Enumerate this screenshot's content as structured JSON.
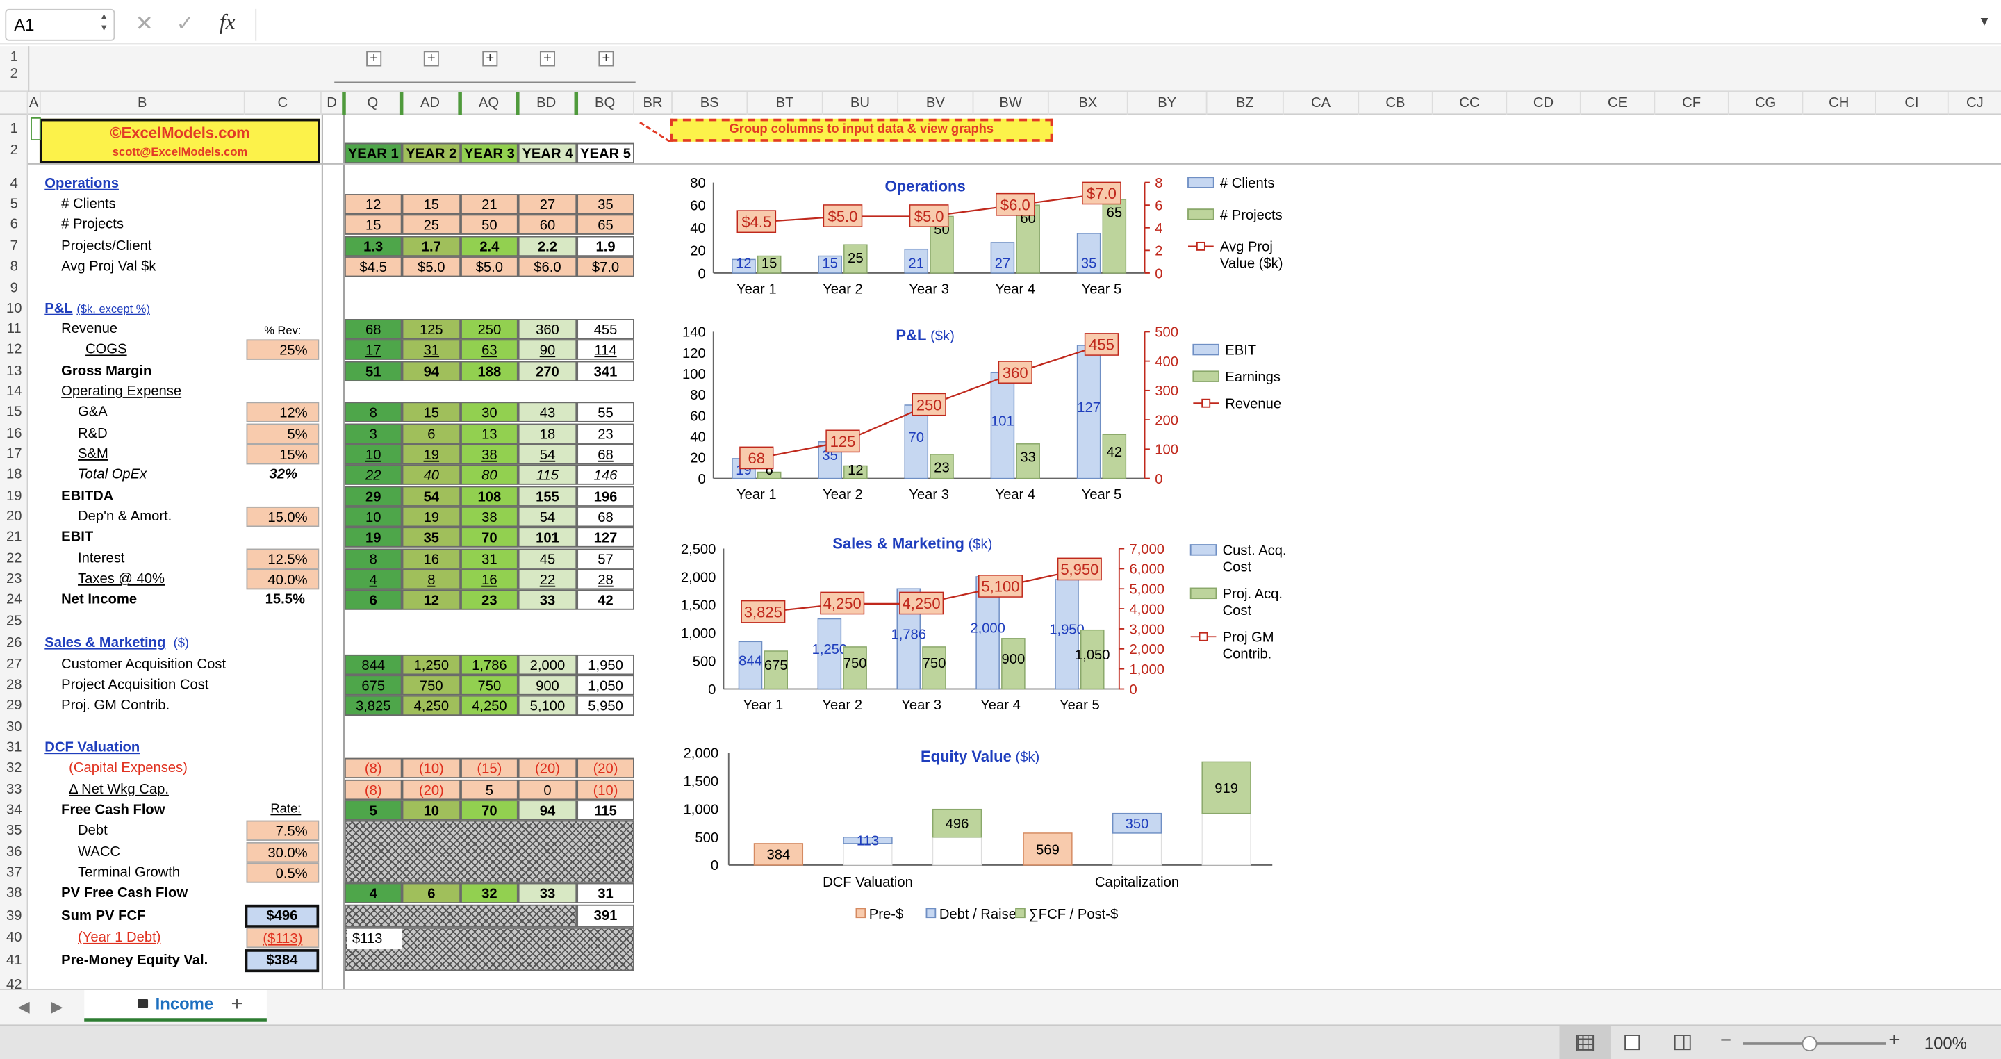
{
  "formula_bar": {
    "cell": "A1",
    "cancel": "✕",
    "confirm": "✓",
    "fx": "fx",
    "formula": ""
  },
  "group_bar": {
    "levels": [
      "1",
      "2"
    ],
    "plus": "+"
  },
  "col_headers": [
    "A",
    "B",
    "C",
    "D",
    "Q",
    "AD",
    "AQ",
    "BD",
    "BQ",
    "BR",
    "BS",
    "BT",
    "BU",
    "BV",
    "BW",
    "BX",
    "BY",
    "BZ",
    "CA",
    "CB",
    "CC",
    "CD",
    "CE",
    "CF",
    "CG",
    "CH",
    "CI",
    "CJ"
  ],
  "row_headers": [
    "1",
    "2",
    "",
    "4",
    "5",
    "6",
    "7",
    "8",
    "9",
    "10",
    "11",
    "12",
    "13",
    "14",
    "15",
    "16",
    "17",
    "18",
    "19",
    "20",
    "21",
    "22",
    "23",
    "24",
    "25",
    "26",
    "27",
    "28",
    "29",
    "30",
    "31",
    "32",
    "33",
    "34",
    "35",
    "36",
    "37",
    "38",
    "39",
    "40",
    "41",
    "42"
  ],
  "header": {
    "brand": "©ExcelModels.com",
    "email": "scott@ExcelModels.com",
    "note": "Group columns to input data & view graphs",
    "years": [
      "YEAR 1",
      "YEAR 2",
      "YEAR 3",
      "YEAR 4",
      "YEAR 5"
    ]
  },
  "labels": {
    "ops": "Operations",
    "clients": "# Clients",
    "projects": "# Projects",
    "ppc": "Projects/Client",
    "apv": "Avg Proj Val $k",
    "pl": "P&L",
    "pl_sub": "($k, except %)",
    "pct_rev": "% Rev:",
    "revenue": "Revenue",
    "cogs": "COGS",
    "gm": "Gross Margin",
    "opex": "Operating Expense",
    "ga": "G&A",
    "rd": "R&D",
    "sm": "S&M",
    "total_opex": "Total OpEx",
    "ebitda": "EBITDA",
    "da": "Dep'n & Amort.",
    "ebit": "EBIT",
    "interest": "Interest",
    "taxes": "Taxes @ 40%",
    "ni": "Net Income",
    "sales": "Sales & Marketing",
    "sales_sub": "($)",
    "cac": "Customer Acquisition Cost",
    "pac": "Project Acquisition Cost",
    "pgm": "Proj. GM Contrib.",
    "dcf": "DCF Valuation",
    "capex": "(Capital Expenses)",
    "nwc": "Δ Net Wkg Cap.",
    "fcf": "Free Cash Flow",
    "rate": "Rate:",
    "debt": "Debt",
    "wacc": "WACC",
    "tg": "Terminal Growth",
    "pvfcf": "PV Free Cash Flow",
    "sumpv": "Sum PV FCF",
    "y1debt": "(Year 1 Debt)",
    "premoney": "Pre-Money Equity Val."
  },
  "col_c": {
    "cogs": "25%",
    "ga": "12%",
    "rd": "5%",
    "sm": "15%",
    "total_opex": "32%",
    "da": "15.0%",
    "interest": "12.5%",
    "taxes": "40.0%",
    "ni": "15.5%",
    "debt": "7.5%",
    "wacc": "30.0%",
    "tg": "0.5%",
    "sumpv": "$496",
    "y1debt": "($113)",
    "premoney": "$384"
  },
  "rows": {
    "clients": [
      "12",
      "15",
      "21",
      "27",
      "35"
    ],
    "projects": [
      "15",
      "25",
      "50",
      "60",
      "65"
    ],
    "ppc": [
      "1.3",
      "1.7",
      "2.4",
      "2.2",
      "1.9"
    ],
    "apv": [
      "$4.5",
      "$5.0",
      "$5.0",
      "$6.0",
      "$7.0"
    ],
    "revenue": [
      "68",
      "125",
      "250",
      "360",
      "455"
    ],
    "cogs": [
      "17",
      "31",
      "63",
      "90",
      "114"
    ],
    "gm": [
      "51",
      "94",
      "188",
      "270",
      "341"
    ],
    "ga": [
      "8",
      "15",
      "30",
      "43",
      "55"
    ],
    "rd": [
      "3",
      "6",
      "13",
      "18",
      "23"
    ],
    "sm": [
      "10",
      "19",
      "38",
      "54",
      "68"
    ],
    "total_opex": [
      "22",
      "40",
      "80",
      "115",
      "146"
    ],
    "ebitda": [
      "29",
      "54",
      "108",
      "155",
      "196"
    ],
    "da": [
      "10",
      "19",
      "38",
      "54",
      "68"
    ],
    "ebit": [
      "19",
      "35",
      "70",
      "101",
      "127"
    ],
    "interest": [
      "8",
      "16",
      "31",
      "45",
      "57"
    ],
    "taxes": [
      "4",
      "8",
      "16",
      "22",
      "28"
    ],
    "ni": [
      "6",
      "12",
      "23",
      "33",
      "42"
    ],
    "cac": [
      "844",
      "1,250",
      "1,786",
      "2,000",
      "1,950"
    ],
    "pac": [
      "675",
      "750",
      "750",
      "900",
      "1,050"
    ],
    "pgm": [
      "3,825",
      "4,250",
      "4,250",
      "5,100",
      "5,950"
    ],
    "capex": [
      "(8)",
      "(10)",
      "(15)",
      "(20)",
      "(20)"
    ],
    "nwc": [
      "(8)",
      "(20)",
      "5",
      "0",
      "(10)"
    ],
    "fcf": [
      "5",
      "10",
      "70",
      "94",
      "115"
    ],
    "pvfcf": [
      "4",
      "6",
      "32",
      "33",
      "31"
    ],
    "terminal": "391",
    "y1debt_val": "$113"
  },
  "colors": {
    "green_dark": "#4ea64a",
    "green_mid": "#a0bf5b",
    "green_light": "#92d050",
    "green_pale": "#d8e8c4",
    "peach": "#f8cbad",
    "blue_bar": "#c6d7f1",
    "green_bar": "#bdd49c",
    "red_line": "#c0281c",
    "yellow": "#fcf24a"
  },
  "chart_data": [
    {
      "type": "bar",
      "title": "Operations",
      "categories": [
        "Year 1",
        "Year 2",
        "Year 3",
        "Year 4",
        "Year 5"
      ],
      "series": [
        {
          "name": "# Clients",
          "values": [
            12,
            15,
            21,
            27,
            35
          ]
        },
        {
          "name": "# Projects",
          "values": [
            15,
            25,
            50,
            60,
            65
          ]
        },
        {
          "name": "Avg Proj Value ($k)",
          "type": "line",
          "axis": "right",
          "values": [
            4.5,
            5.0,
            5.0,
            6.0,
            7.0
          ],
          "labels": [
            "$4.5",
            "$5.0",
            "$5.0",
            "$6.0",
            "$7.0"
          ]
        }
      ],
      "ylim": [
        0,
        80
      ],
      "yticks": [
        "0",
        "20",
        "40",
        "60",
        "80"
      ],
      "y2lim": [
        0,
        8
      ],
      "y2ticks": [
        "0",
        "2",
        "4",
        "6",
        "8"
      ],
      "legend": "right"
    },
    {
      "type": "bar",
      "title": "P&L",
      "title_sub": "($k)",
      "categories": [
        "Year 1",
        "Year 2",
        "Year 3",
        "Year 4",
        "Year 5"
      ],
      "series": [
        {
          "name": "EBIT",
          "values": [
            19,
            35,
            70,
            101,
            127
          ],
          "labels": [
            "19",
            "35",
            "70",
            "101",
            "127"
          ]
        },
        {
          "name": "Earnings",
          "values": [
            6,
            12,
            23,
            33,
            42
          ],
          "labels": [
            "6",
            "12",
            "23",
            "33",
            "42"
          ]
        },
        {
          "name": "Revenue",
          "type": "line",
          "axis": "right",
          "values": [
            68,
            125,
            250,
            360,
            455
          ],
          "labels": [
            "68",
            "125",
            "250",
            "360",
            "455"
          ]
        }
      ],
      "ylim": [
        0,
        140
      ],
      "yticks": [
        "0",
        "20",
        "40",
        "60",
        "80",
        "100",
        "120",
        "140"
      ],
      "y2lim": [
        0,
        500
      ],
      "y2ticks": [
        "0",
        "100",
        "200",
        "300",
        "400",
        "500"
      ],
      "legend": "right"
    },
    {
      "type": "bar",
      "title": "Sales & Marketing",
      "title_sub": "($k)",
      "categories": [
        "Year 1",
        "Year 2",
        "Year 3",
        "Year 4",
        "Year 5"
      ],
      "series": [
        {
          "name": "Cust. Acq. Cost",
          "values": [
            844,
            1250,
            1786,
            2000,
            1950
          ],
          "labels": [
            "844",
            "1,250",
            "1,786",
            "2,000",
            "1,950"
          ]
        },
        {
          "name": "Proj. Acq. Cost",
          "values": [
            675,
            750,
            750,
            900,
            1050
          ],
          "labels": [
            "675",
            "750",
            "750",
            "900",
            "1,050"
          ]
        },
        {
          "name": "Proj GM Contrib.",
          "type": "line",
          "axis": "right",
          "values": [
            3825,
            4250,
            4250,
            5100,
            5950
          ],
          "labels": [
            "3,825",
            "4,250",
            "4,250",
            "5,100",
            "5,950"
          ]
        }
      ],
      "ylim": [
        0,
        2500
      ],
      "yticks": [
        "0",
        "500",
        "1,000",
        "1,500",
        "2,000",
        "2,500"
      ],
      "y2lim": [
        0,
        7000
      ],
      "y2ticks": [
        "0",
        "1,000",
        "2,000",
        "3,000",
        "4,000",
        "5,000",
        "6,000",
        "7,000"
      ],
      "legend": "right"
    },
    {
      "type": "bar",
      "title": "Equity Value",
      "title_sub": "($k)",
      "categories": [
        "DCF Valuation",
        "Capitalization"
      ],
      "series": [
        {
          "name": "Pre-$",
          "values": [
            384,
            569
          ]
        },
        {
          "name": "Debt / Raise",
          "values": [
            113,
            350
          ]
        },
        {
          "name": "∑FCF / Post-$",
          "values": [
            496,
            919
          ]
        }
      ],
      "ylim": [
        0,
        2000
      ],
      "yticks": [
        "0",
        "500",
        "1,000",
        "1,500",
        "2,000"
      ],
      "legend": "bottom"
    }
  ],
  "sheet_tab": "Income",
  "add_sheet": "+",
  "status": {
    "zoom": "100%"
  }
}
